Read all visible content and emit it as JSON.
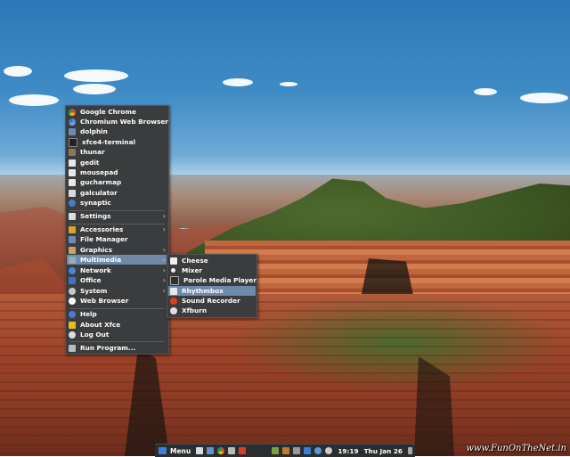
{
  "app_menu": {
    "favorites": [
      {
        "label": "Google Chrome",
        "icon": "chrome-icon"
      },
      {
        "label": "Chromium Web Browser",
        "icon": "chromium-icon"
      },
      {
        "label": "dolphin",
        "icon": "folder-icon"
      },
      {
        "label": "xfce4-terminal",
        "icon": "terminal-icon"
      },
      {
        "label": "thunar",
        "icon": "file-manager-icon"
      },
      {
        "label": "gedit",
        "icon": "text-editor-icon"
      },
      {
        "label": "mousepad",
        "icon": "text-editor-icon"
      },
      {
        "label": "gucharmap",
        "icon": "character-map-icon"
      },
      {
        "label": "galculator",
        "icon": "calculator-icon"
      },
      {
        "label": "synaptic",
        "icon": "package-manager-icon"
      }
    ],
    "settings": {
      "label": "Settings",
      "icon": "settings-icon",
      "has_submenu": true
    },
    "categories": [
      {
        "label": "Accessories",
        "icon": "accessories-icon",
        "has_submenu": true
      },
      {
        "label": "File Manager",
        "icon": "folder-icon",
        "has_submenu": false
      },
      {
        "label": "Graphics",
        "icon": "graphics-icon",
        "has_submenu": true
      },
      {
        "label": "Multimedia",
        "icon": "multimedia-icon",
        "has_submenu": true,
        "selected": true
      },
      {
        "label": "Network",
        "icon": "network-icon",
        "has_submenu": true
      },
      {
        "label": "Office",
        "icon": "office-icon",
        "has_submenu": true
      },
      {
        "label": "System",
        "icon": "system-icon",
        "has_submenu": true
      },
      {
        "label": "Web Browser",
        "icon": "web-browser-icon",
        "has_submenu": false
      }
    ],
    "session": [
      {
        "label": "Help",
        "icon": "help-icon"
      },
      {
        "label": "About Xfce",
        "icon": "about-icon"
      },
      {
        "label": "Log Out",
        "icon": "logout-icon"
      }
    ],
    "run": {
      "label": "Run Program...",
      "icon": "run-icon"
    }
  },
  "multimedia_submenu": {
    "items": [
      {
        "label": "Cheese",
        "icon": "cheese-icon"
      },
      {
        "label": "Mixer",
        "icon": "mixer-icon"
      },
      {
        "label": "Parole Media Player",
        "icon": "media-player-icon"
      },
      {
        "label": "Rhythmbox",
        "icon": "rhythmbox-icon",
        "selected": true
      },
      {
        "label": "Sound Recorder",
        "icon": "sound-recorder-icon"
      },
      {
        "label": "Xfburn",
        "icon": "disc-burner-icon"
      }
    ]
  },
  "panel": {
    "menu_label": "Menu",
    "clock": "19:19",
    "date": "Thu Jan 26"
  },
  "watermark": "www.FunOnTheNet.in",
  "colors": {
    "menu_bg": "#3a3c3e",
    "selection": "#6d8aa9",
    "panel_bg": "#2b2d2f"
  }
}
